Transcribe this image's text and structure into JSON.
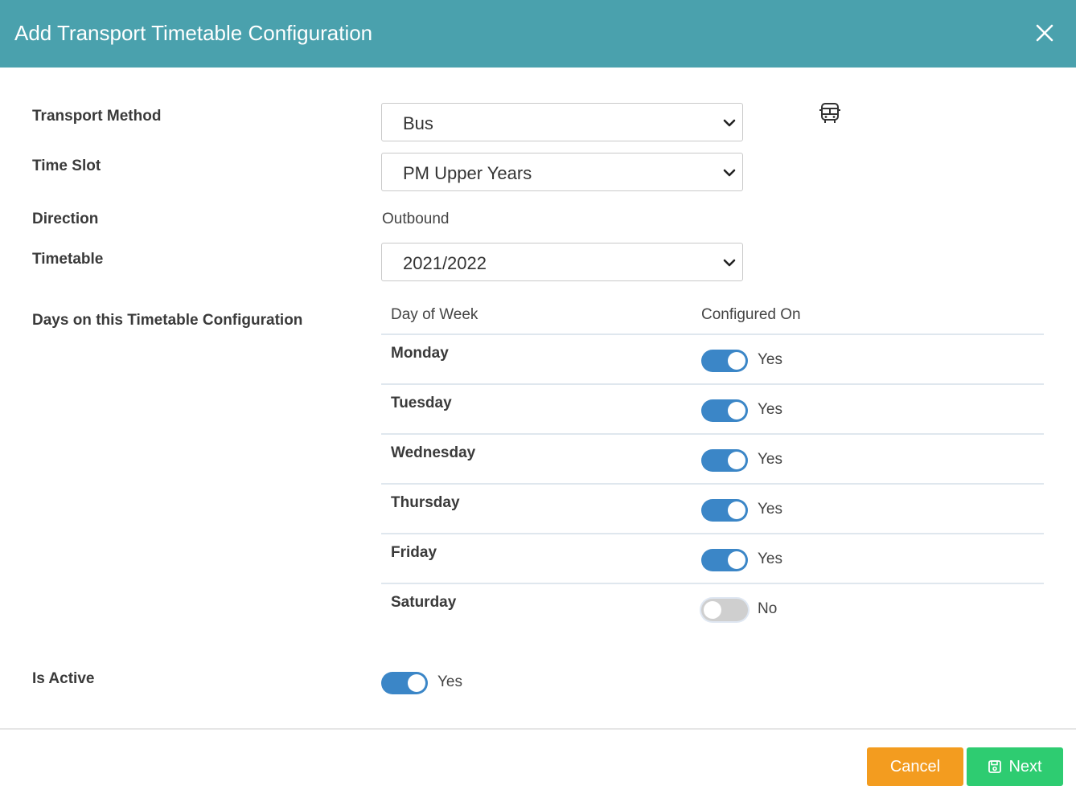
{
  "header": {
    "title": "Add Transport Timetable Configuration",
    "background": "#4aa1ad"
  },
  "form": {
    "transport_method": {
      "label": "Transport Method",
      "value": "Bus",
      "icon": "bus-icon"
    },
    "time_slot": {
      "label": "Time Slot",
      "value": "PM Upper Years"
    },
    "direction": {
      "label": "Direction",
      "value": "Outbound"
    },
    "timetable": {
      "label": "Timetable",
      "value": "2021/2022"
    },
    "days": {
      "label": "Days on this Timetable Configuration",
      "columns": [
        "Day of Week",
        "Configured On"
      ],
      "rows": [
        {
          "day": "Monday",
          "on": true,
          "status": "Yes"
        },
        {
          "day": "Tuesday",
          "on": true,
          "status": "Yes"
        },
        {
          "day": "Wednesday",
          "on": true,
          "status": "Yes"
        },
        {
          "day": "Thursday",
          "on": true,
          "status": "Yes"
        },
        {
          "day": "Friday",
          "on": true,
          "status": "Yes"
        },
        {
          "day": "Saturday",
          "on": false,
          "status": "No"
        }
      ]
    },
    "is_active": {
      "label": "Is Active",
      "on": true,
      "status": "Yes"
    }
  },
  "footer": {
    "cancel_label": "Cancel",
    "next_label": "Next",
    "cancel_color": "#f39c1f",
    "next_color": "#2ecc71",
    "toggle_on_color": "#3b86c7"
  }
}
